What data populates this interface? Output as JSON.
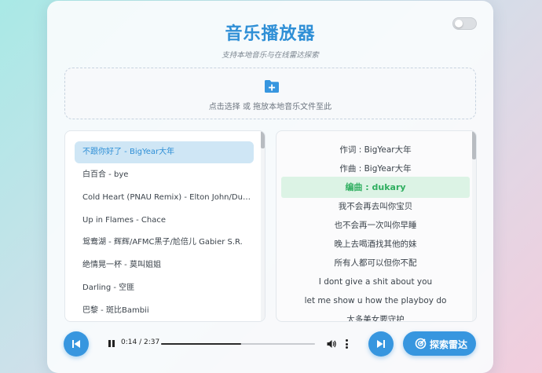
{
  "app": {
    "title": "音乐播放器",
    "subtitle": "支持本地音乐与在线雷达探索"
  },
  "upload": {
    "hint": "点击选择 或 拖放本地音乐文件至此",
    "icon": "folder-plus-icon"
  },
  "playlist": {
    "active_index": 0,
    "items": [
      "不跟你好了 - BigYear大年",
      "白百合 - bye",
      "Cold Heart (PNAU Remix) - Elton John/Dua Lipa",
      "Up in Flames - Chace",
      "鸳鸯湖 - 辉辉/AFMC黑子/尬倍儿 Gabier S.R.",
      "绝情晃一杯 - 莫叫姐姐",
      "Darling - 空匪",
      "巴黎 - 斑比Bambii"
    ]
  },
  "lyrics": {
    "active_index": 2,
    "lines": [
      "作词 : BigYear大年",
      "作曲 : BigYear大年",
      "编曲 : dukary",
      "我不会再去叫你宝贝",
      "也不会再一次叫你早睡",
      "晚上去喝酒找其他的妹",
      "所有人都可以但你不配",
      "I dont give a shit about you",
      "let me show u how the playboy do",
      "太多美女要守护"
    ]
  },
  "player": {
    "current_time": "0:14",
    "separator": " / ",
    "duration": "2:37",
    "progress": 0.52,
    "radar_label": "探索雷达"
  },
  "colors": {
    "accent": "#3796df",
    "title": "#2f8fd6",
    "active_lyric": "#2eae5f"
  }
}
